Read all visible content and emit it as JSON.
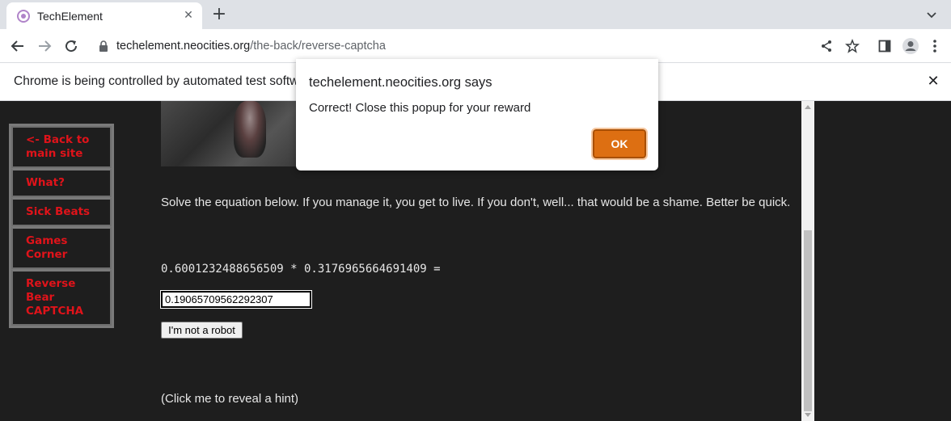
{
  "browser": {
    "tab_title": "TechElement",
    "url_host": "techelement.neocities.org",
    "url_path": "/the-back/reverse-captcha",
    "infobar_text": "Chrome is being controlled by automated test software."
  },
  "sidebar": {
    "items": [
      {
        "label": "<- Back to main site"
      },
      {
        "label": "What?"
      },
      {
        "label": "Sick Beats"
      },
      {
        "label": "Games Corner"
      },
      {
        "label": "Reverse Bear CAPTCHA"
      }
    ]
  },
  "main": {
    "intro": "Solve the equation below. If you manage it, you get to live. If you don't, well... that would be a shame. Better be quick.",
    "equation": "0.6001232488656509 * 0.3176965664691409 =",
    "answer_value": "0.19065709562292307",
    "robot_button": "I'm not a robot",
    "hint": "(Click me to reveal a hint)"
  },
  "dialog": {
    "title": "techelement.neocities.org says",
    "message": "Correct! Close this popup for your reward",
    "ok_label": "OK"
  },
  "colors": {
    "page_bg": "#1e1e1e",
    "link_red": "#e0131a",
    "ok_orange": "#dd6f12"
  }
}
